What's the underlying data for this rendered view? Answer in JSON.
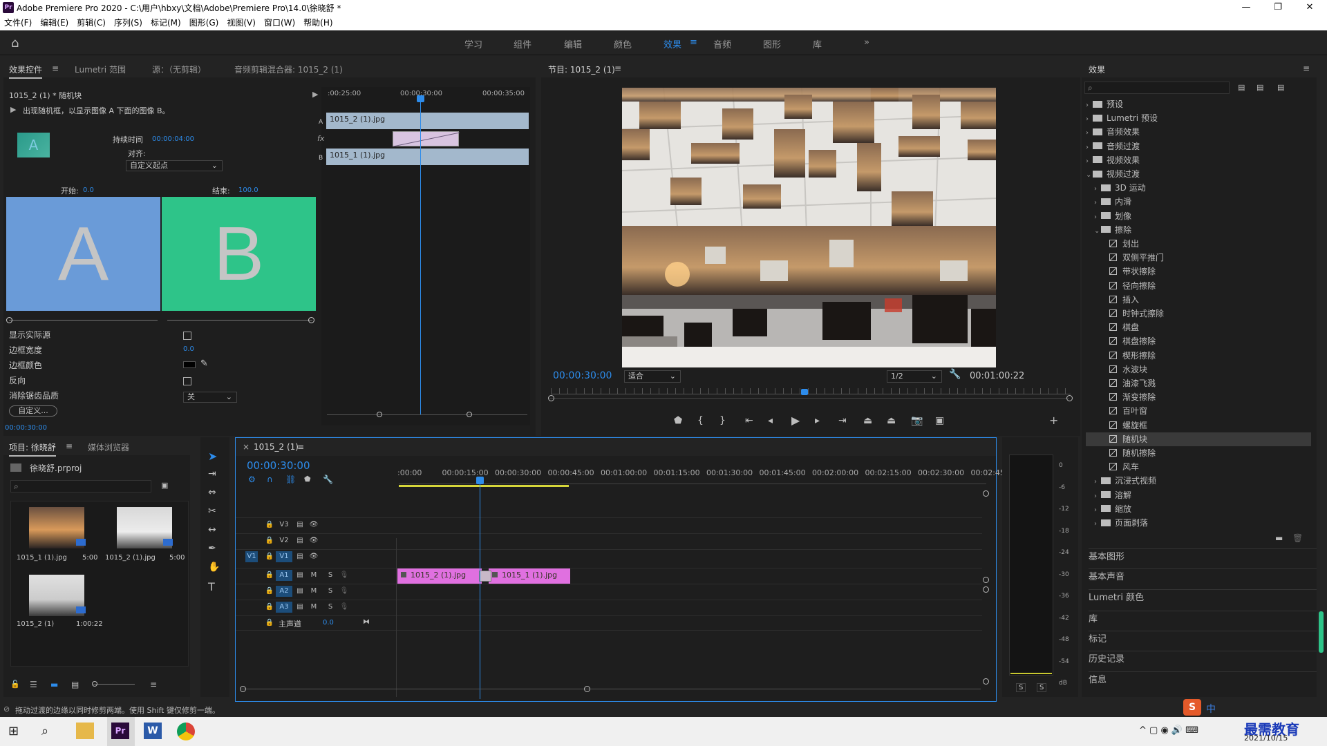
{
  "window": {
    "title": "Adobe Premiere Pro 2020 - C:\\用户\\hbxy\\文档\\Adobe\\Premiere Pro\\14.0\\徐晓舒 *",
    "app_icon": "Pr"
  },
  "menu": [
    "文件(F)",
    "编辑(E)",
    "剪辑(C)",
    "序列(S)",
    "标记(M)",
    "图形(G)",
    "视图(V)",
    "窗口(W)",
    "帮助(H)"
  ],
  "workspaces": [
    "学习",
    "组件",
    "编辑",
    "颜色",
    "效果",
    "音频",
    "图形",
    "库"
  ],
  "workspace_active": "效果",
  "effect_controls": {
    "tabs": [
      "效果控件",
      "Lumetri 范围",
      "源：（无剪辑）",
      "音频剪辑混合器: 1015_2 (1)"
    ],
    "clip_name": "1015_2 (1) * 随机块",
    "description": "出现随机框，以显示图像 A 下面的图像 B。",
    "duration_label": "持续时间",
    "duration_value": "00:00:04:00",
    "align_label": "对齐:",
    "align_value": "自定义起点",
    "start_label": "开始:",
    "start_value": "0.0",
    "end_label": "结束:",
    "end_value": "100.0",
    "preview_a": "A",
    "preview_b": "B",
    "preview_a_color": "#6a9bd8",
    "preview_b_color": "#2ec489",
    "show_actual_source": "显示实际源",
    "border_width": "边框宽度",
    "border_width_value": "0.0",
    "border_color": "边框颜色",
    "reverse": "反向",
    "antialias": "消除锯齿品质",
    "antialias_value": "关",
    "custom_button": "自定义...",
    "timecode": "00:00:30:00",
    "mini_ruler": [
      ":00:25:00",
      "00:00:30:00",
      "00:00:35:00"
    ],
    "mini_track_a_clip": "1015_2 (1).jpg",
    "mini_track_b_clip": "1015_1 (1).jpg",
    "mini_track_a_label": "A",
    "mini_track_b_label": "B",
    "fx_label": "fx"
  },
  "program": {
    "title": "节目: 1015_2 (1)",
    "timecode": "00:00:30:00",
    "fit": "适合",
    "resolution": "1/2",
    "duration": "00:01:00:22"
  },
  "effects_panel": {
    "title": "效果",
    "tree": [
      {
        "label": "预设",
        "level": 0,
        "kind": "folder",
        "open": false
      },
      {
        "label": "Lumetri 预设",
        "level": 0,
        "kind": "folder",
        "open": false
      },
      {
        "label": "音频效果",
        "level": 0,
        "kind": "folder",
        "open": false
      },
      {
        "label": "音频过渡",
        "level": 0,
        "kind": "folder",
        "open": false
      },
      {
        "label": "视频效果",
        "level": 0,
        "kind": "folder",
        "open": false
      },
      {
        "label": "视频过渡",
        "level": 0,
        "kind": "folder",
        "open": true
      },
      {
        "label": "3D 运动",
        "level": 1,
        "kind": "folder",
        "open": false
      },
      {
        "label": "内滑",
        "level": 1,
        "kind": "folder",
        "open": false
      },
      {
        "label": "划像",
        "level": 1,
        "kind": "folder",
        "open": false
      },
      {
        "label": "擦除",
        "level": 1,
        "kind": "folder",
        "open": true
      },
      {
        "label": "划出",
        "level": 2,
        "kind": "fx"
      },
      {
        "label": "双侧平推门",
        "level": 2,
        "kind": "fx"
      },
      {
        "label": "带状擦除",
        "level": 2,
        "kind": "fx"
      },
      {
        "label": "径向擦除",
        "level": 2,
        "kind": "fx"
      },
      {
        "label": "插入",
        "level": 2,
        "kind": "fx"
      },
      {
        "label": "时钟式擦除",
        "level": 2,
        "kind": "fx"
      },
      {
        "label": "棋盘",
        "level": 2,
        "kind": "fx"
      },
      {
        "label": "棋盘擦除",
        "level": 2,
        "kind": "fx"
      },
      {
        "label": "楔形擦除",
        "level": 2,
        "kind": "fx"
      },
      {
        "label": "水波块",
        "level": 2,
        "kind": "fx"
      },
      {
        "label": "油漆飞溅",
        "level": 2,
        "kind": "fx"
      },
      {
        "label": "渐变擦除",
        "level": 2,
        "kind": "fx"
      },
      {
        "label": "百叶窗",
        "level": 2,
        "kind": "fx"
      },
      {
        "label": "螺旋框",
        "level": 2,
        "kind": "fx"
      },
      {
        "label": "随机块",
        "level": 2,
        "kind": "fx",
        "selected": true
      },
      {
        "label": "随机擦除",
        "level": 2,
        "kind": "fx"
      },
      {
        "label": "风车",
        "level": 2,
        "kind": "fx"
      },
      {
        "label": "沉浸式视频",
        "level": 1,
        "kind": "folder",
        "open": false
      },
      {
        "label": "溶解",
        "level": 1,
        "kind": "folder",
        "open": false
      },
      {
        "label": "缩放",
        "level": 1,
        "kind": "folder",
        "open": false
      },
      {
        "label": "页面剥落",
        "level": 1,
        "kind": "folder",
        "open": false
      }
    ],
    "sections": [
      "基本图形",
      "基本声音",
      "Lumetri 颜色",
      "库",
      "标记",
      "历史记录",
      "信息"
    ]
  },
  "project": {
    "tabs": [
      "项目: 徐晓舒",
      "媒体浏览器"
    ],
    "file": "徐晓舒.prproj",
    "items": [
      {
        "name": "1015_1 (1).jpg",
        "dur": "5:00"
      },
      {
        "name": "1015_2 (1).jpg",
        "dur": "5:00"
      },
      {
        "name": "1015_2 (1)",
        "dur": "1:00:22"
      }
    ]
  },
  "timeline": {
    "tab": "1015_2 (1)",
    "timecode": "00:00:30:00",
    "ruler": [
      ":00:00",
      "00:00:15:00",
      "00:00:30:00",
      "00:00:45:00",
      "00:01:00:00",
      "00:01:15:00",
      "00:01:30:00",
      "00:01:45:00",
      "00:02:00:00",
      "00:02:15:00",
      "00:02:30:00",
      "00:02:45:"
    ],
    "tracks": [
      {
        "id": "V3",
        "kind": "video"
      },
      {
        "id": "V2",
        "kind": "video"
      },
      {
        "id": "V1",
        "kind": "video",
        "src": "V1"
      },
      {
        "id": "A1",
        "kind": "audio"
      },
      {
        "id": "A2",
        "kind": "audio"
      },
      {
        "id": "A3",
        "kind": "audio"
      }
    ],
    "master_label": "主声道",
    "master_value": "0.0",
    "clip1": "1015_2 (1).jpg",
    "clip2": "1015_1 (1).jpg",
    "clip_color": "#e070e0",
    "ms": [
      "M",
      "S"
    ]
  },
  "meter": {
    "scale": [
      "0",
      "-6",
      "-12",
      "-18",
      "-24",
      "-30",
      "-36",
      "-42",
      "-48",
      "-54",
      "dB"
    ],
    "solo": [
      "S",
      "S"
    ]
  },
  "status": "拖动过渡的边缘以同时修剪两端。使用 Shift 键仅修剪一端。",
  "taskbar": {
    "date": "2021/10/15",
    "ime": "中",
    "watermark": "最需教育"
  }
}
